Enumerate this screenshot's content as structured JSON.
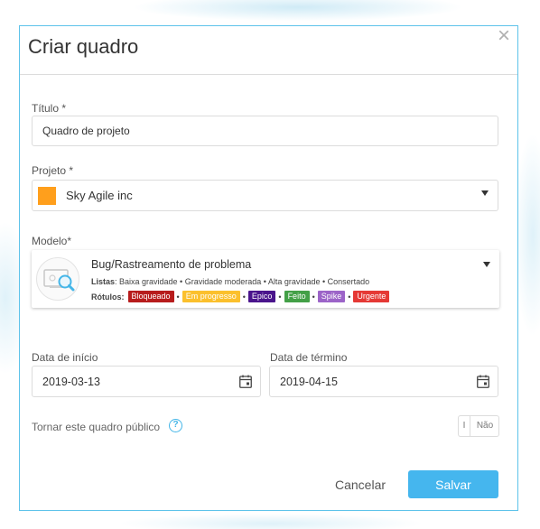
{
  "dialog": {
    "title": "Criar quadro",
    "close_symbol": "×"
  },
  "title_field": {
    "label": "Título *",
    "value": "Quadro de projeto"
  },
  "project_field": {
    "label": "Projeto *",
    "value": "Sky Agile inc",
    "swatch_color": "#ff9f1c"
  },
  "template_field": {
    "label": "Modelo*",
    "name": "Bug/Rastreamento de problema",
    "lists_prefix": "Listas",
    "lists": [
      "Baixa gravidade",
      "Gravidade moderada",
      "Alta gravidade",
      "Consertado"
    ],
    "lists_text": ": Baixa gravidade • Gravidade moderada • Alta gravidade • Consertado",
    "labels_prefix": "Rótulos:",
    "labels": [
      {
        "name": "Bloqueado",
        "color": "#b71c1c"
      },
      {
        "name": "Em progresso",
        "color": "#fbc02d"
      },
      {
        "name": "Epico",
        "color": "#4a148c"
      },
      {
        "name": "Feito",
        "color": "#43a047"
      },
      {
        "name": "Spike",
        "color": "#9c64c8"
      },
      {
        "name": "Urgente",
        "color": "#e53935"
      }
    ],
    "separator": "•"
  },
  "start_date": {
    "label": "Data de início",
    "value": "2019-03-13"
  },
  "end_date": {
    "label": "Data de término",
    "value": "2019-04-15"
  },
  "public_toggle": {
    "label": "Tornar este quadro público",
    "help_symbol": "?",
    "on_text": "I",
    "off_text": "Não"
  },
  "actions": {
    "cancel_label": "Cancelar",
    "save_label": "Salvar",
    "save_color": "#45b6ee"
  },
  "colors": {
    "accent_border": "#5ec3ea",
    "help_icon": "#45b6e8"
  }
}
